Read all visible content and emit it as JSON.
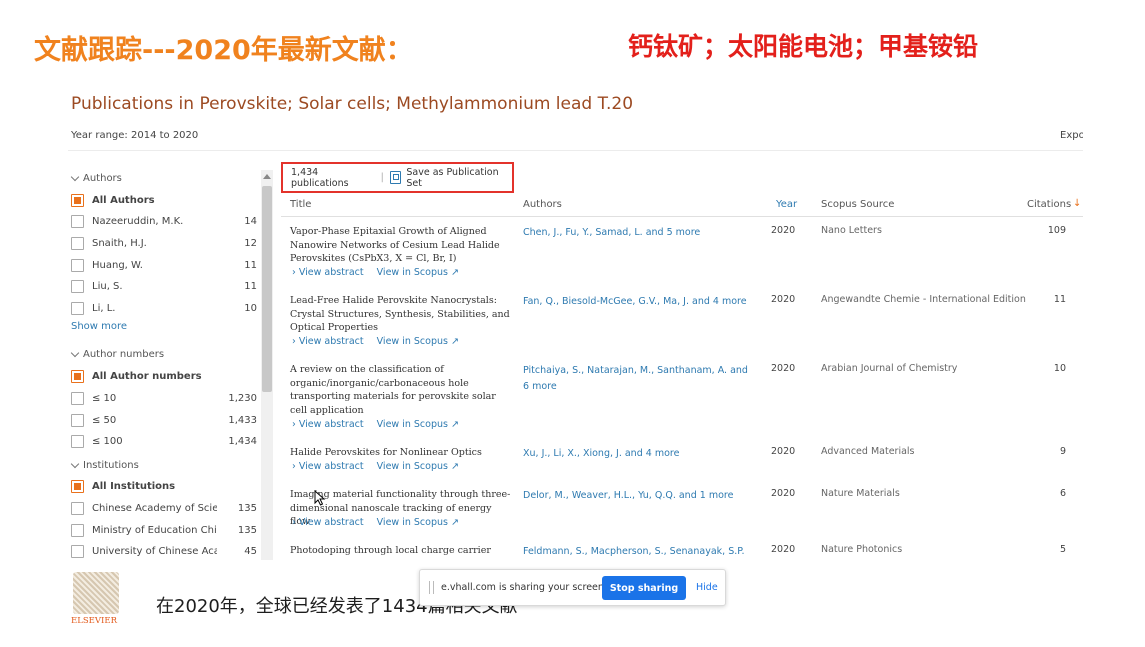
{
  "slide": {
    "title": "文献跟踪---2020年最新文献：",
    "tag": "钙钛矿；太阳能电池；甲基铵铅",
    "subtitle": "在2020年，全球已经发表了1434篇相关文献"
  },
  "scopus": {
    "heading": "Publications in Perovskite; Solar cells; Methylammonium lead T.20",
    "year_range": "Year range: 2014 to 2020",
    "export_label": "Expo"
  },
  "sidebar": {
    "authors": {
      "header": "Authors",
      "all_label": "All Authors",
      "items": [
        {
          "label": "Nazeeruddin, M.K.",
          "count": "14"
        },
        {
          "label": "Snaith, H.J.",
          "count": "12"
        },
        {
          "label": "Huang, W.",
          "count": "11"
        },
        {
          "label": "Liu, S.",
          "count": "11"
        },
        {
          "label": "Li, L.",
          "count": "10"
        }
      ],
      "show_more": "Show more"
    },
    "author_numbers": {
      "header": "Author numbers",
      "all_label": "All Author numbers",
      "items": [
        {
          "label": "≤ 10",
          "count": "1,230"
        },
        {
          "label": "≤ 50",
          "count": "1,433"
        },
        {
          "label": "≤ 100",
          "count": "1,434"
        }
      ]
    },
    "institutions": {
      "header": "Institutions",
      "all_label": "All Institutions",
      "items": [
        {
          "label": "Chinese Academy of Sciences",
          "count": "135"
        },
        {
          "label": "Ministry of Education China",
          "count": "135"
        },
        {
          "label": "University of Chinese Academy",
          "count": "45"
        }
      ]
    }
  },
  "results": {
    "count_label": "1,434 publications",
    "save_label": "Save as Publication Set",
    "columns": {
      "title": "Title",
      "authors": "Authors",
      "year": "Year",
      "source": "Scopus Source",
      "citations": "Citations"
    },
    "view_abstract": "View abstract",
    "view_in_scopus": "View in Scopus ↗",
    "rows": [
      {
        "title": "Vapor-Phase Epitaxial Growth of Aligned Nanowire Networks of Cesium Lead Halide Perovskites (CsPbX3, X = Cl, Br, I)",
        "authors": "Chen, J., Fu, Y., Samad, L. and 5 more",
        "year": "2020",
        "source": "Nano Letters",
        "citations": "109"
      },
      {
        "title": "Lead-Free Halide Perovskite Nanocrystals: Crystal Structures, Synthesis, Stabilities, and Optical Properties",
        "authors": "Fan, Q., Biesold-McGee, G.V., Ma, J. and 4 more",
        "year": "2020",
        "source": "Angewandte Chemie - International Edition",
        "citations": "11"
      },
      {
        "title": "A review on the classification of organic/inorganic/carbonaceous hole transporting materials for perovskite solar cell application",
        "authors": "Pitchaiya, S., Natarajan, M., Santhanam, A. and 6 more",
        "year": "2020",
        "source": "Arabian Journal of Chemistry",
        "citations": "10"
      },
      {
        "title": "Halide Perovskites for Nonlinear Optics",
        "authors": "Xu, J., Li, X., Xiong, J. and 4 more",
        "year": "2020",
        "source": "Advanced Materials",
        "citations": "9"
      },
      {
        "title": "Imaging material functionality through three-dimensional nanoscale tracking of energy flow",
        "authors": "Delor, M., Weaver, H.L., Yu, Q.Q. and 1 more",
        "year": "2020",
        "source": "Nature Materials",
        "citations": "6"
      },
      {
        "title": "Photodoping through local charge carrier",
        "authors": "Feldmann, S., Macpherson, S., Senanayak, S.P.",
        "year": "2020",
        "source": "Nature Photonics",
        "citations": "5"
      }
    ]
  },
  "sharebar": {
    "message": "e.vhall.com is sharing your screen.",
    "stop_label": "Stop sharing",
    "hide_label": "Hide"
  },
  "logo": {
    "word": "ELSEVIER"
  },
  "colors": {
    "slide_title": "#f0821e",
    "slide_tag": "#e3201b",
    "heading": "#9c4a22",
    "link": "#2e7ab0",
    "accent": "#e9711c",
    "highlight_box": "#e3322b",
    "stop_button": "#1a73e8"
  }
}
